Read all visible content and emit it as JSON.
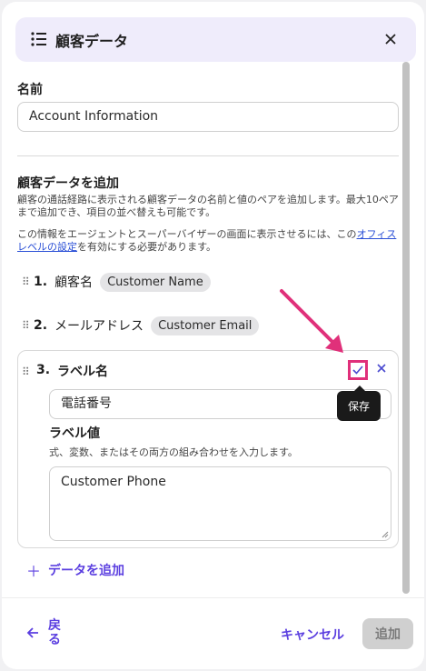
{
  "header": {
    "title": "顧客データ",
    "icon": "list-icon"
  },
  "name_field": {
    "label": "名前",
    "value": "Account Information"
  },
  "section": {
    "title": "顧客データを追加",
    "description1": "顧客の通話経路に表示される顧客データの名前と値のペアを追加します。最大10ペアまで追加でき、項目の並べ替えも可能です。",
    "description2_prefix": "この情報をエージェントとスーパーバイザーの画面に表示させるには、この",
    "description2_link": "オフィスレベルの設定",
    "description2_suffix": "を有効にする必要があります。"
  },
  "items": [
    {
      "num": "1.",
      "label": "顧客名",
      "value": "Customer Name"
    },
    {
      "num": "2.",
      "label": "メールアドレス",
      "value": "Customer Email"
    }
  ],
  "editing": {
    "num": "3.",
    "label_title": "ラベル名",
    "label_value": "電話番号",
    "value_title": "ラベル値",
    "value_hint": "式、変数、またはその両方の組み合わせを入力します。",
    "value_text": "Customer Phone",
    "tooltip": "保存"
  },
  "add_data_label": "データを追加",
  "footer": {
    "back_label": "戻る",
    "cancel_label": "キャンセル",
    "add_label": "追加"
  },
  "colors": {
    "accent": "#5b3fe0",
    "highlight": "#e0307a",
    "header_bg": "#efecfb"
  }
}
